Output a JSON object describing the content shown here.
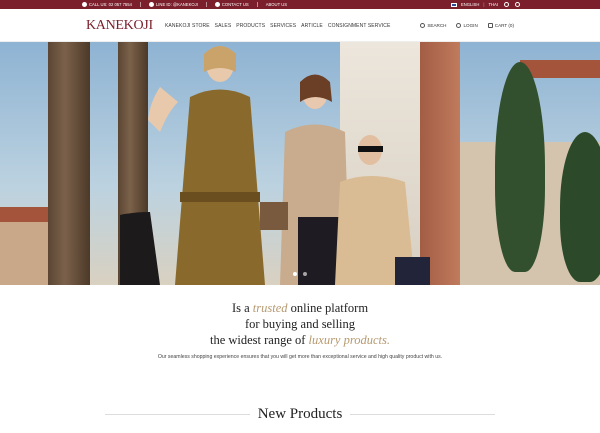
{
  "topbar": {
    "phone": "CALL US: 02 057 7554",
    "line": "LINE ID: @KANEKOJI",
    "contact": "CONTACT US",
    "about": "ABOUT US",
    "lang_en": "ENGLISH",
    "lang_th": "THAI"
  },
  "header": {
    "logo": "KANEKOJI",
    "nav": [
      "KANEKOJI STORE",
      "SALES",
      "PRODUCTS",
      "SERVICES",
      "ARTICLE",
      "CONSIGNMENT SERVICE"
    ],
    "search": "SEARCH",
    "login": "LOGIN",
    "cart": "CART (0)"
  },
  "hero": {
    "slides": 2,
    "active_slide": 1
  },
  "intro": {
    "line1_a": "Is a ",
    "line1_em": "trusted",
    "line1_b": " online platform",
    "line2": "for buying and selling",
    "line3_a": "the widest range of ",
    "line3_em": "luxury products.",
    "subtext": "Our seamless shopping experience ensures that you will get more than exceptional service and high quality product with us."
  },
  "section": {
    "title": "New Products"
  },
  "colors": {
    "brand": "#7a1f2b",
    "accent": "#b6996f"
  }
}
